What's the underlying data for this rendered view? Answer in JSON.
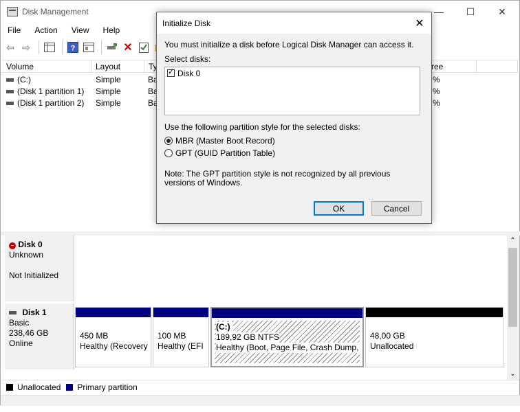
{
  "window": {
    "title": "Disk Management",
    "minimize": "—",
    "maximize": "☐",
    "close": "✕"
  },
  "menu": [
    "File",
    "Action",
    "View",
    "Help"
  ],
  "volumes": {
    "headers": [
      "Volume",
      "Layout",
      "Ty",
      "ree"
    ],
    "rows": [
      {
        "volume": "(C:)",
        "layout": "Simple",
        "type": "Ba",
        "pct": "%"
      },
      {
        "volume": "(Disk 1 partition 1)",
        "layout": "Simple",
        "type": "Ba",
        "pct": "%"
      },
      {
        "volume": "(Disk 1 partition 2)",
        "layout": "Simple",
        "type": "Ba",
        "pct": "%"
      }
    ]
  },
  "disk0": {
    "name": "Disk 0",
    "type": "Unknown",
    "state": "Not Initialized"
  },
  "disk1": {
    "name": "Disk 1",
    "type": "Basic",
    "size": "238,46 GB",
    "status": "Online",
    "partitions": [
      {
        "title": "",
        "size": "450 MB",
        "status": "Healthy (Recovery"
      },
      {
        "title": "",
        "size": "100 MB",
        "status": "Healthy (EFI S"
      },
      {
        "title": "(C:)",
        "size": "189,92 GB NTFS",
        "status": "Healthy (Boot, Page File, Crash Dump, P"
      },
      {
        "title": "",
        "size": "48,00 GB",
        "status": "Unallocated"
      }
    ]
  },
  "legend": {
    "unallocated": "Unallocated",
    "primary": "Primary partition"
  },
  "colors": {
    "primary": "#000080",
    "unallocated": "#000000",
    "dialog_border": "#1979ca",
    "default_button": "#0078d7"
  },
  "dialog": {
    "title": "Initialize Disk",
    "message": "You must initialize a disk before Logical Disk Manager can access it.",
    "select_label": "Select disks:",
    "disk_item": "Disk 0",
    "style_label": "Use the following partition style for the selected disks:",
    "mbr": "MBR (Master Boot Record)",
    "gpt": "GPT (GUID Partition Table)",
    "note": "Note: The GPT partition style is not recognized by all previous versions of Windows.",
    "ok": "OK",
    "cancel": "Cancel"
  }
}
